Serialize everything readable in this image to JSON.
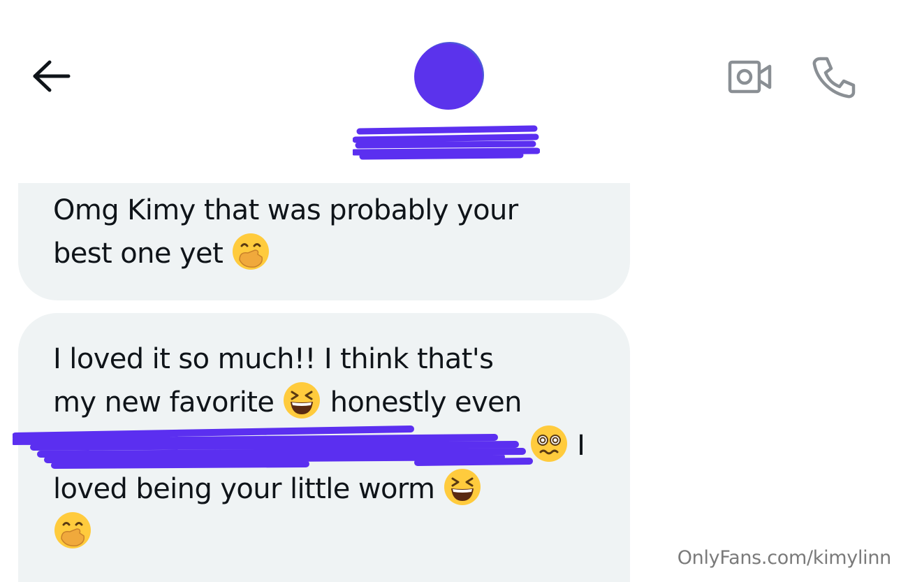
{
  "header": {
    "back_icon": "arrow-left-icon",
    "video_icon": "video-call-icon",
    "call_icon": "phone-icon",
    "avatar_color": "#5b33ec",
    "redaction_color": "#5b2ff0"
  },
  "messages": [
    {
      "lines": [
        "Omg Kimy that was probably your",
        "best one yet"
      ],
      "line_emojis": [
        "",
        "hand-over-mouth-emoji"
      ]
    },
    {
      "lines": [
        "I loved it so much!! I think that's",
        "my new favorite",
        "honestly even",
        "I",
        "loved being your little worm"
      ],
      "emojis": {
        "favorite": "grinning-squinting-face-emoji",
        "dizzy": "face-with-spiral-eyes-emoji",
        "worm": "grinning-squinting-face-emoji",
        "last": "hand-over-mouth-emoji"
      }
    }
  ],
  "bubble_color": "#eff3f4",
  "text_color": "#0f1419",
  "watermark": "OnlyFans.com/kimylinn"
}
